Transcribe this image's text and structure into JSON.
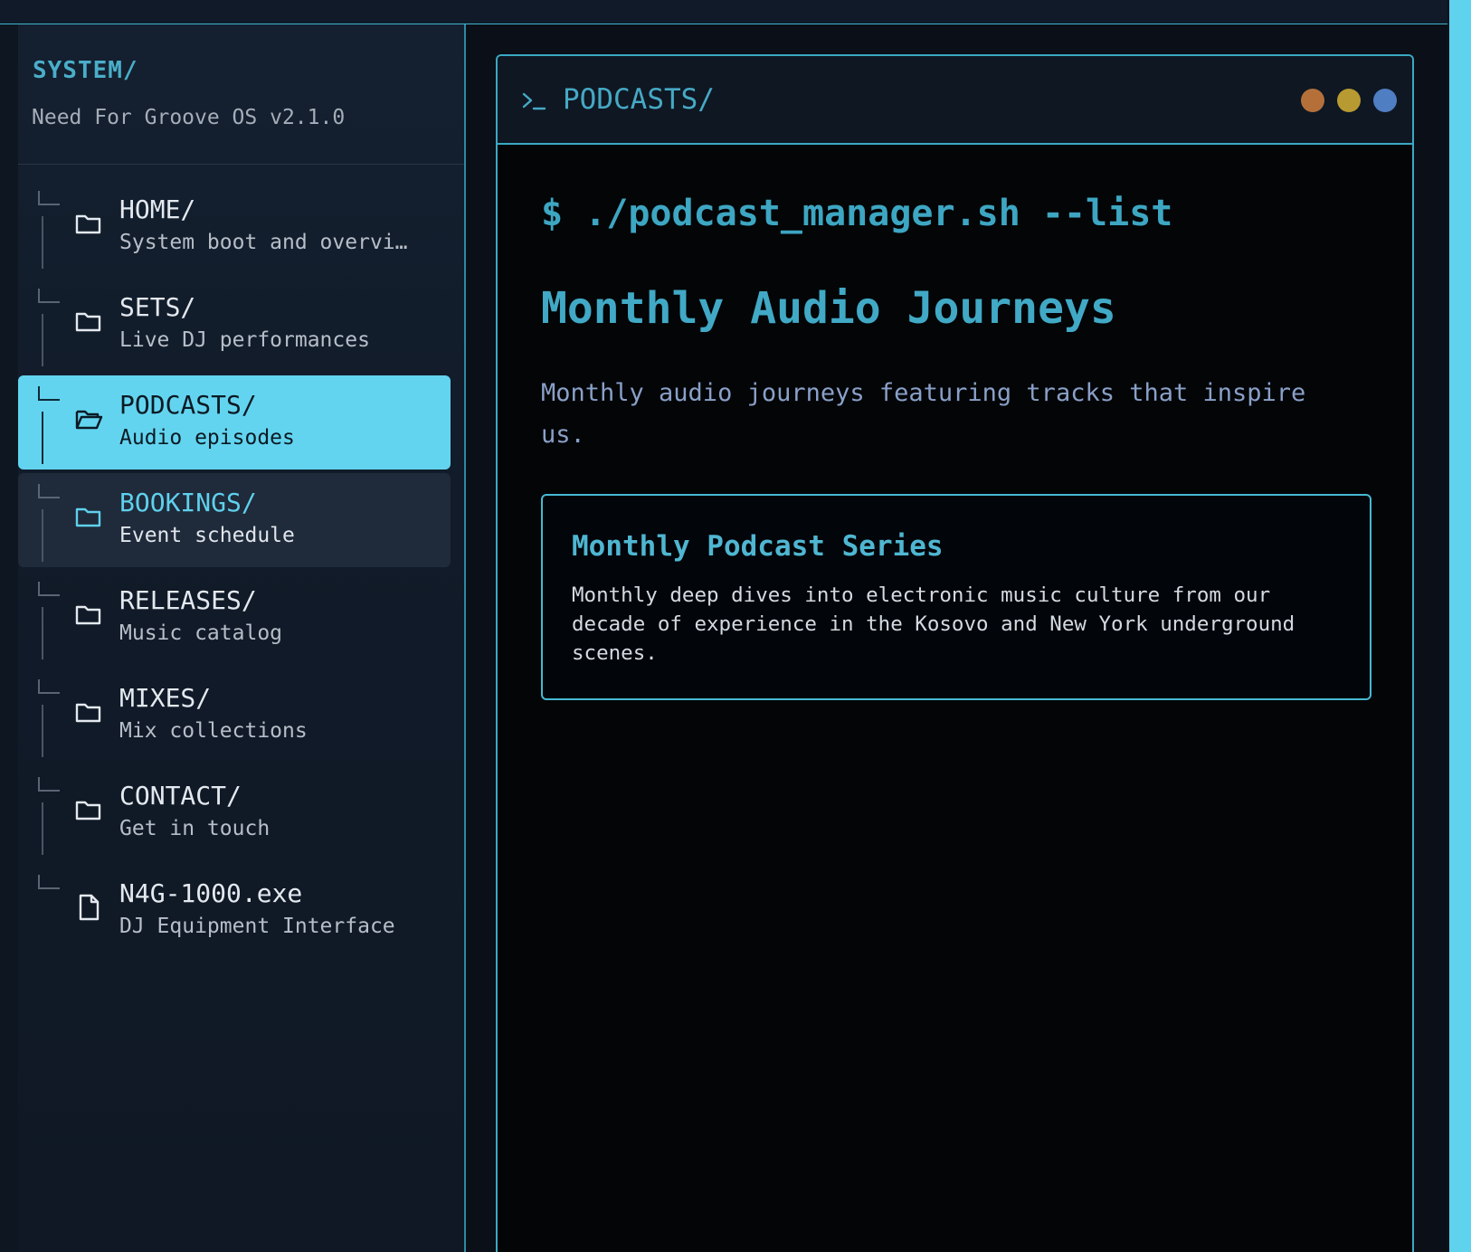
{
  "sidebar": {
    "title": "SYSTEM/",
    "subtitle": "Need For Groove OS v2.1.0",
    "items": [
      {
        "label": "HOME/",
        "desc": "System boot and overvi…",
        "icon": "folder-icon"
      },
      {
        "label": "SETS/",
        "desc": "Live DJ performances",
        "icon": "folder-icon"
      },
      {
        "label": "PODCASTS/",
        "desc": "Audio episodes",
        "icon": "folder-open-icon",
        "state": "active"
      },
      {
        "label": "BOOKINGS/",
        "desc": "Event schedule",
        "icon": "folder-icon",
        "state": "hover"
      },
      {
        "label": "RELEASES/",
        "desc": "Music catalog",
        "icon": "folder-icon"
      },
      {
        "label": "MIXES/",
        "desc": "Mix collections",
        "icon": "folder-icon"
      },
      {
        "label": "CONTACT/",
        "desc": "Get in touch",
        "icon": "folder-icon"
      },
      {
        "label": "N4G-1000.exe",
        "desc": "DJ Equipment Interface",
        "icon": "file-icon"
      }
    ]
  },
  "window": {
    "title": "PODCASTS/",
    "prompt_icon": "terminal-prompt-icon",
    "dots": [
      "#b5703a",
      "#b89a32",
      "#4f7ec2"
    ]
  },
  "main": {
    "command": "$ ./podcast_manager.sh --list",
    "heading": "Monthly Audio Journeys",
    "lead": "Monthly audio journeys featuring tracks that inspire us.",
    "card": {
      "title": "Monthly Podcast Series",
      "body": "Monthly deep dives into electronic music culture from our decade of experience in the Kosovo and New York underground scenes."
    }
  },
  "colors": {
    "accent": "#63d4ef",
    "border": "#3aa9c4",
    "background": "#030507"
  }
}
